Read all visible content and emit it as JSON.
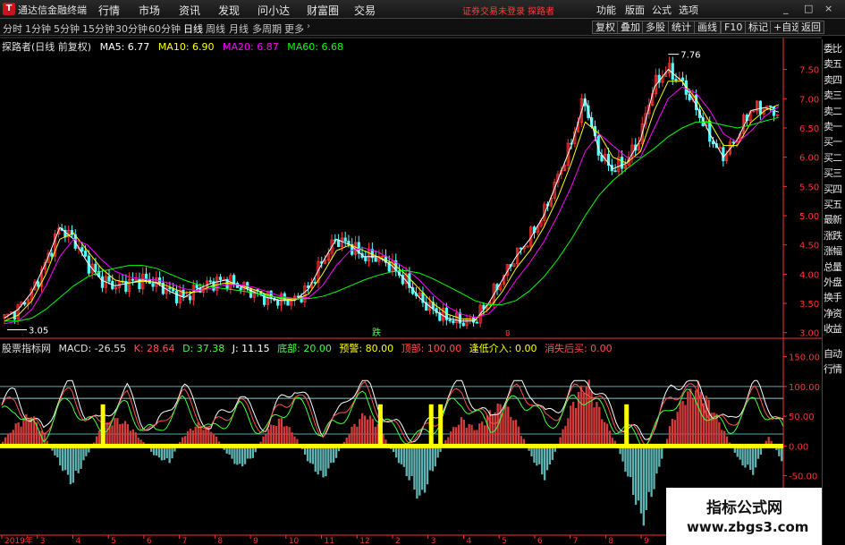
{
  "window": {
    "title": "通达信金融终端",
    "logo_char": "T",
    "menu": [
      "行情",
      "市场",
      "资讯",
      "发现",
      "问小达",
      "财富圈",
      "交易"
    ],
    "login_status": "证券交易未登录  探路者",
    "tools": [
      "功能",
      "版面",
      "公式",
      "选项"
    ],
    "controls": [
      "_",
      "□",
      "×"
    ]
  },
  "toolbar": {
    "periods": [
      "分时",
      "1分钟",
      "5分钟",
      "15分钟",
      "30分钟",
      "60分钟",
      "日线",
      "周线",
      "月线",
      "多周期",
      "更多"
    ],
    "active_period": "日线",
    "right_buttons": [
      "复权",
      "叠加",
      "多股",
      "统计",
      "画线",
      "F10",
      "标记",
      "+自选",
      "返回"
    ]
  },
  "chart_info": {
    "stock": "探路者(日线 前复权)",
    "ma5": "MA5: 6.77",
    "ma10": "MA10: 6.90",
    "ma20": "MA20: 6.87",
    "ma60": "MA60: 6.68"
  },
  "side_panel": [
    "委比",
    "卖五",
    "卖四",
    "卖三",
    "卖二",
    "卖一",
    "买一",
    "买二",
    "买三",
    "买四",
    "买五",
    "最新",
    "涨跌",
    "涨幅",
    "总量",
    "外盘",
    "换手",
    "净资",
    "收益"
  ],
  "side_bottom": [
    "自动",
    "行情"
  ],
  "indicator_info": {
    "name": "股票指标网",
    "macd": "MACD: -26.55",
    "k": "K: 28.64",
    "d": "D: 37.38",
    "j": "J: 11.15",
    "bottom": "底部: 20.00",
    "warn": "预警: 80.00",
    "top": "顶部: 100.00",
    "buy": "逢低介入: 0.00",
    "sell": "消失后买: 0.00"
  },
  "markers": {
    "high": "7.76",
    "low": "3.05",
    "mid": "跌",
    "small": "B"
  },
  "colors": {
    "ma5": "#ffffff",
    "ma10": "#ffff00",
    "ma20": "#ff00ff",
    "ma60": "#00ff00",
    "up": "#ff3232",
    "down": "#54ffff",
    "axis": "#ff3232",
    "yellow": "#ffff00"
  },
  "chart_data": [
    {
      "type": "candlestick",
      "title": "探路者(日线 前复权)",
      "yticks": [
        "7.50",
        "7.00",
        "6.50",
        "6.00",
        "5.50",
        "5.00",
        "4.50",
        "4.00",
        "3.50",
        "3.00"
      ],
      "ylim": [
        2.95,
        7.8
      ],
      "series": [
        {
          "name": "MA5",
          "values": [
            3.25,
            3.4,
            3.7,
            4.2,
            4.8,
            4.6,
            4.2,
            3.9,
            3.8,
            3.85,
            3.9,
            3.85,
            3.7,
            3.6,
            3.75,
            3.85,
            3.9,
            3.8,
            3.7,
            3.6,
            3.55,
            3.55,
            3.75,
            4.2,
            4.6,
            4.5,
            4.3,
            4.3,
            4.15,
            3.9,
            3.6,
            3.4,
            3.25,
            3.2,
            3.2,
            3.5,
            3.9,
            4.3,
            4.6,
            5.0,
            5.6,
            6.2,
            7.0,
            6.1,
            5.8,
            5.9,
            6.3,
            7.2,
            7.5,
            7.3,
            6.9,
            6.4,
            6.0,
            6.3,
            6.8,
            6.85,
            6.77
          ]
        },
        {
          "name": "MA10",
          "values": [
            3.2,
            3.3,
            3.55,
            4.0,
            4.6,
            4.7,
            4.4,
            4.1,
            3.9,
            3.85,
            3.88,
            3.86,
            3.78,
            3.68,
            3.7,
            3.8,
            3.85,
            3.82,
            3.74,
            3.65,
            3.58,
            3.56,
            3.66,
            4.0,
            4.4,
            4.5,
            4.4,
            4.3,
            4.2,
            4.0,
            3.75,
            3.5,
            3.32,
            3.24,
            3.22,
            3.4,
            3.7,
            4.1,
            4.4,
            4.8,
            5.3,
            5.9,
            6.6,
            6.4,
            6.0,
            5.9,
            6.1,
            6.8,
            7.3,
            7.3,
            7.0,
            6.6,
            6.2,
            6.2,
            6.6,
            6.8,
            6.9
          ]
        },
        {
          "name": "MA20",
          "values": [
            3.15,
            3.2,
            3.4,
            3.8,
            4.3,
            4.6,
            4.5,
            4.25,
            4.05,
            3.95,
            3.92,
            3.9,
            3.84,
            3.75,
            3.72,
            3.76,
            3.82,
            3.82,
            3.78,
            3.7,
            3.62,
            3.58,
            3.6,
            3.8,
            4.15,
            4.4,
            4.45,
            4.38,
            4.25,
            4.1,
            3.9,
            3.65,
            3.45,
            3.32,
            3.26,
            3.32,
            3.55,
            3.9,
            4.2,
            4.55,
            5.0,
            5.5,
            6.1,
            6.4,
            6.2,
            6.0,
            6.0,
            6.5,
            7.0,
            7.2,
            7.1,
            6.8,
            6.4,
            6.25,
            6.45,
            6.7,
            6.87
          ]
        },
        {
          "name": "MA60",
          "values": [
            3.2,
            3.2,
            3.25,
            3.4,
            3.6,
            3.8,
            3.95,
            4.05,
            4.1,
            4.15,
            4.15,
            4.1,
            4.0,
            3.9,
            3.82,
            3.78,
            3.75,
            3.72,
            3.68,
            3.63,
            3.6,
            3.58,
            3.58,
            3.62,
            3.7,
            3.8,
            3.9,
            3.98,
            4.04,
            4.06,
            4.02,
            3.92,
            3.8,
            3.68,
            3.55,
            3.48,
            3.48,
            3.55,
            3.72,
            3.95,
            4.25,
            4.6,
            5.0,
            5.35,
            5.6,
            5.8,
            5.98,
            6.15,
            6.35,
            6.5,
            6.6,
            6.6,
            6.55,
            6.5,
            6.55,
            6.62,
            6.68
          ]
        }
      ]
    },
    {
      "type": "bar",
      "title": "股票指标网",
      "yticks": [
        "150.00",
        "100.00",
        "50.00",
        "0.00",
        "-50.00"
      ],
      "ylim": [
        -150,
        160
      ],
      "levels": [
        {
          "name": "顶部",
          "value": 100
        },
        {
          "name": "预警",
          "value": 80
        },
        {
          "name": "底部",
          "value": 20
        },
        {
          "name": "base",
          "value": 0
        }
      ],
      "xticks": [
        "2019年",
        "3",
        "4",
        "5",
        "6",
        "7",
        "8",
        "9",
        "10",
        "11",
        "12",
        "2",
        "3",
        "4",
        "5",
        "6",
        "7",
        "8",
        "9",
        "10",
        "11",
        "12"
      ],
      "signal_positions": [
        0.13,
        0.485,
        0.55,
        0.562,
        0.8
      ],
      "macd": [
        10,
        40,
        60,
        20,
        -30,
        -70,
        -20,
        30,
        50,
        40,
        10,
        -20,
        -30,
        20,
        40,
        30,
        -10,
        -40,
        -20,
        30,
        50,
        20,
        -30,
        -60,
        -20,
        30,
        60,
        40,
        -10,
        -50,
        -100,
        -40,
        20,
        50,
        30,
        60,
        80,
        40,
        -20,
        -60,
        10,
        80,
        120,
        60,
        10,
        -60,
        -140,
        -60,
        40,
        90,
        110,
        70,
        20,
        -30,
        -50,
        20,
        -26.55
      ],
      "kdj_k": [
        60,
        80,
        40,
        20,
        70,
        90,
        50,
        30,
        60,
        80,
        40,
        20,
        60,
        85,
        55,
        25,
        50,
        75,
        45,
        30,
        65,
        90,
        60,
        25,
        40,
        80,
        95,
        60,
        30,
        20,
        15,
        40,
        75,
        90,
        60,
        35,
        70,
        95,
        80,
        40,
        60,
        90,
        100,
        70,
        40,
        25,
        10,
        40,
        85,
        100,
        80,
        50,
        30,
        60,
        90,
        60,
        28.64
      ]
    }
  ]
}
